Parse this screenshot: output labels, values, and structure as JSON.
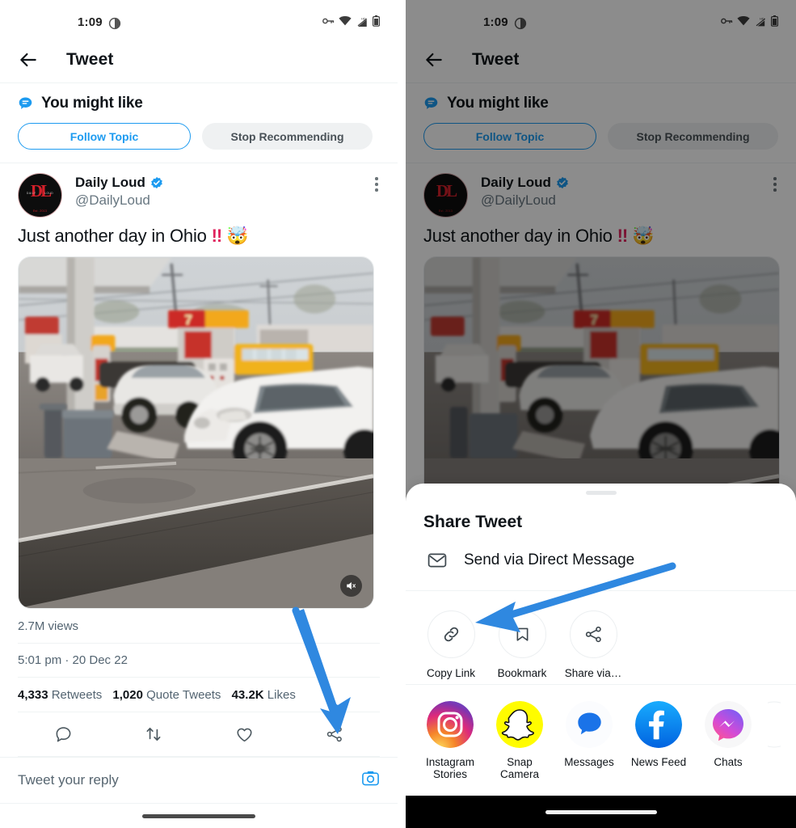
{
  "status_bar": {
    "time": "1:09",
    "icons": [
      "dnd-icon",
      "vpn-key-icon",
      "wifi-icon",
      "signal-hd-icon",
      "battery-icon"
    ]
  },
  "app_bar": {
    "back_label": "back-arrow",
    "title": "Tweet"
  },
  "you_might_like": {
    "title": "You might like",
    "follow_label": "Follow Topic",
    "stop_label": "Stop Recommending"
  },
  "tweet": {
    "display_name": "Daily Loud",
    "verified": true,
    "handle": "@DailyLoud",
    "avatar_initials": "DL",
    "avatar_left_text": "DAILY",
    "avatar_right_text": "LOUD",
    "avatar_est": "Est. 2013",
    "text": "Just another day in Ohio",
    "emoji_bangs": "!!",
    "emoji_mind_blown": "🤯",
    "media_type": "video",
    "mute_state": "muted",
    "views": "2.7M views",
    "timestamp": "5:01 pm · 20 Dec 22",
    "counts": {
      "retweets_value": "4,333",
      "retweets_label": "Retweets",
      "quotes_value": "1,020",
      "quotes_label": "Quote Tweets",
      "likes_value": "43.2K",
      "likes_label": "Likes"
    },
    "actions": [
      "reply-icon",
      "retweet-icon",
      "like-icon",
      "share-icon"
    ]
  },
  "composer": {
    "placeholder": "Tweet your reply",
    "camera_icon": "camera-icon"
  },
  "share_sheet": {
    "title": "Share Tweet",
    "dm_label": "Send via Direct Message",
    "actions": [
      {
        "label": "Copy Link",
        "icon": "link-icon"
      },
      {
        "label": "Bookmark",
        "icon": "bookmark-icon"
      },
      {
        "label": "Share via…",
        "icon": "share-icon"
      }
    ],
    "apps": [
      {
        "label": "Instagram\nStories",
        "line1": "Instagram",
        "line2": "Stories",
        "icon": "instagram-icon",
        "color": "#d62976"
      },
      {
        "label": "Snap Camera",
        "line1": "Snap",
        "line2": "Camera",
        "icon": "snapchat-icon",
        "color": "#fffc00"
      },
      {
        "label": "Messages",
        "line1": "Messages",
        "line2": "",
        "icon": "google-messages-icon",
        "color": "#1a73e8"
      },
      {
        "label": "News Feed",
        "line1": "News Feed",
        "line2": "",
        "icon": "facebook-icon",
        "color": "#1877f2"
      },
      {
        "label": "Chats",
        "line1": "Chats",
        "line2": "",
        "icon": "messenger-icon",
        "color": "#a033ff"
      }
    ]
  },
  "annotations": {
    "arrow_color": "#2f88e0",
    "arrow_1_target": "share-icon",
    "arrow_2_target": "copy-link-button"
  },
  "colors": {
    "twitter_blue": "#1d9bf0",
    "text_primary": "#0f1419",
    "text_secondary": "#536471",
    "divider": "#eff3f4",
    "dim_overlay": "rgba(0,0,0,0.45)"
  }
}
